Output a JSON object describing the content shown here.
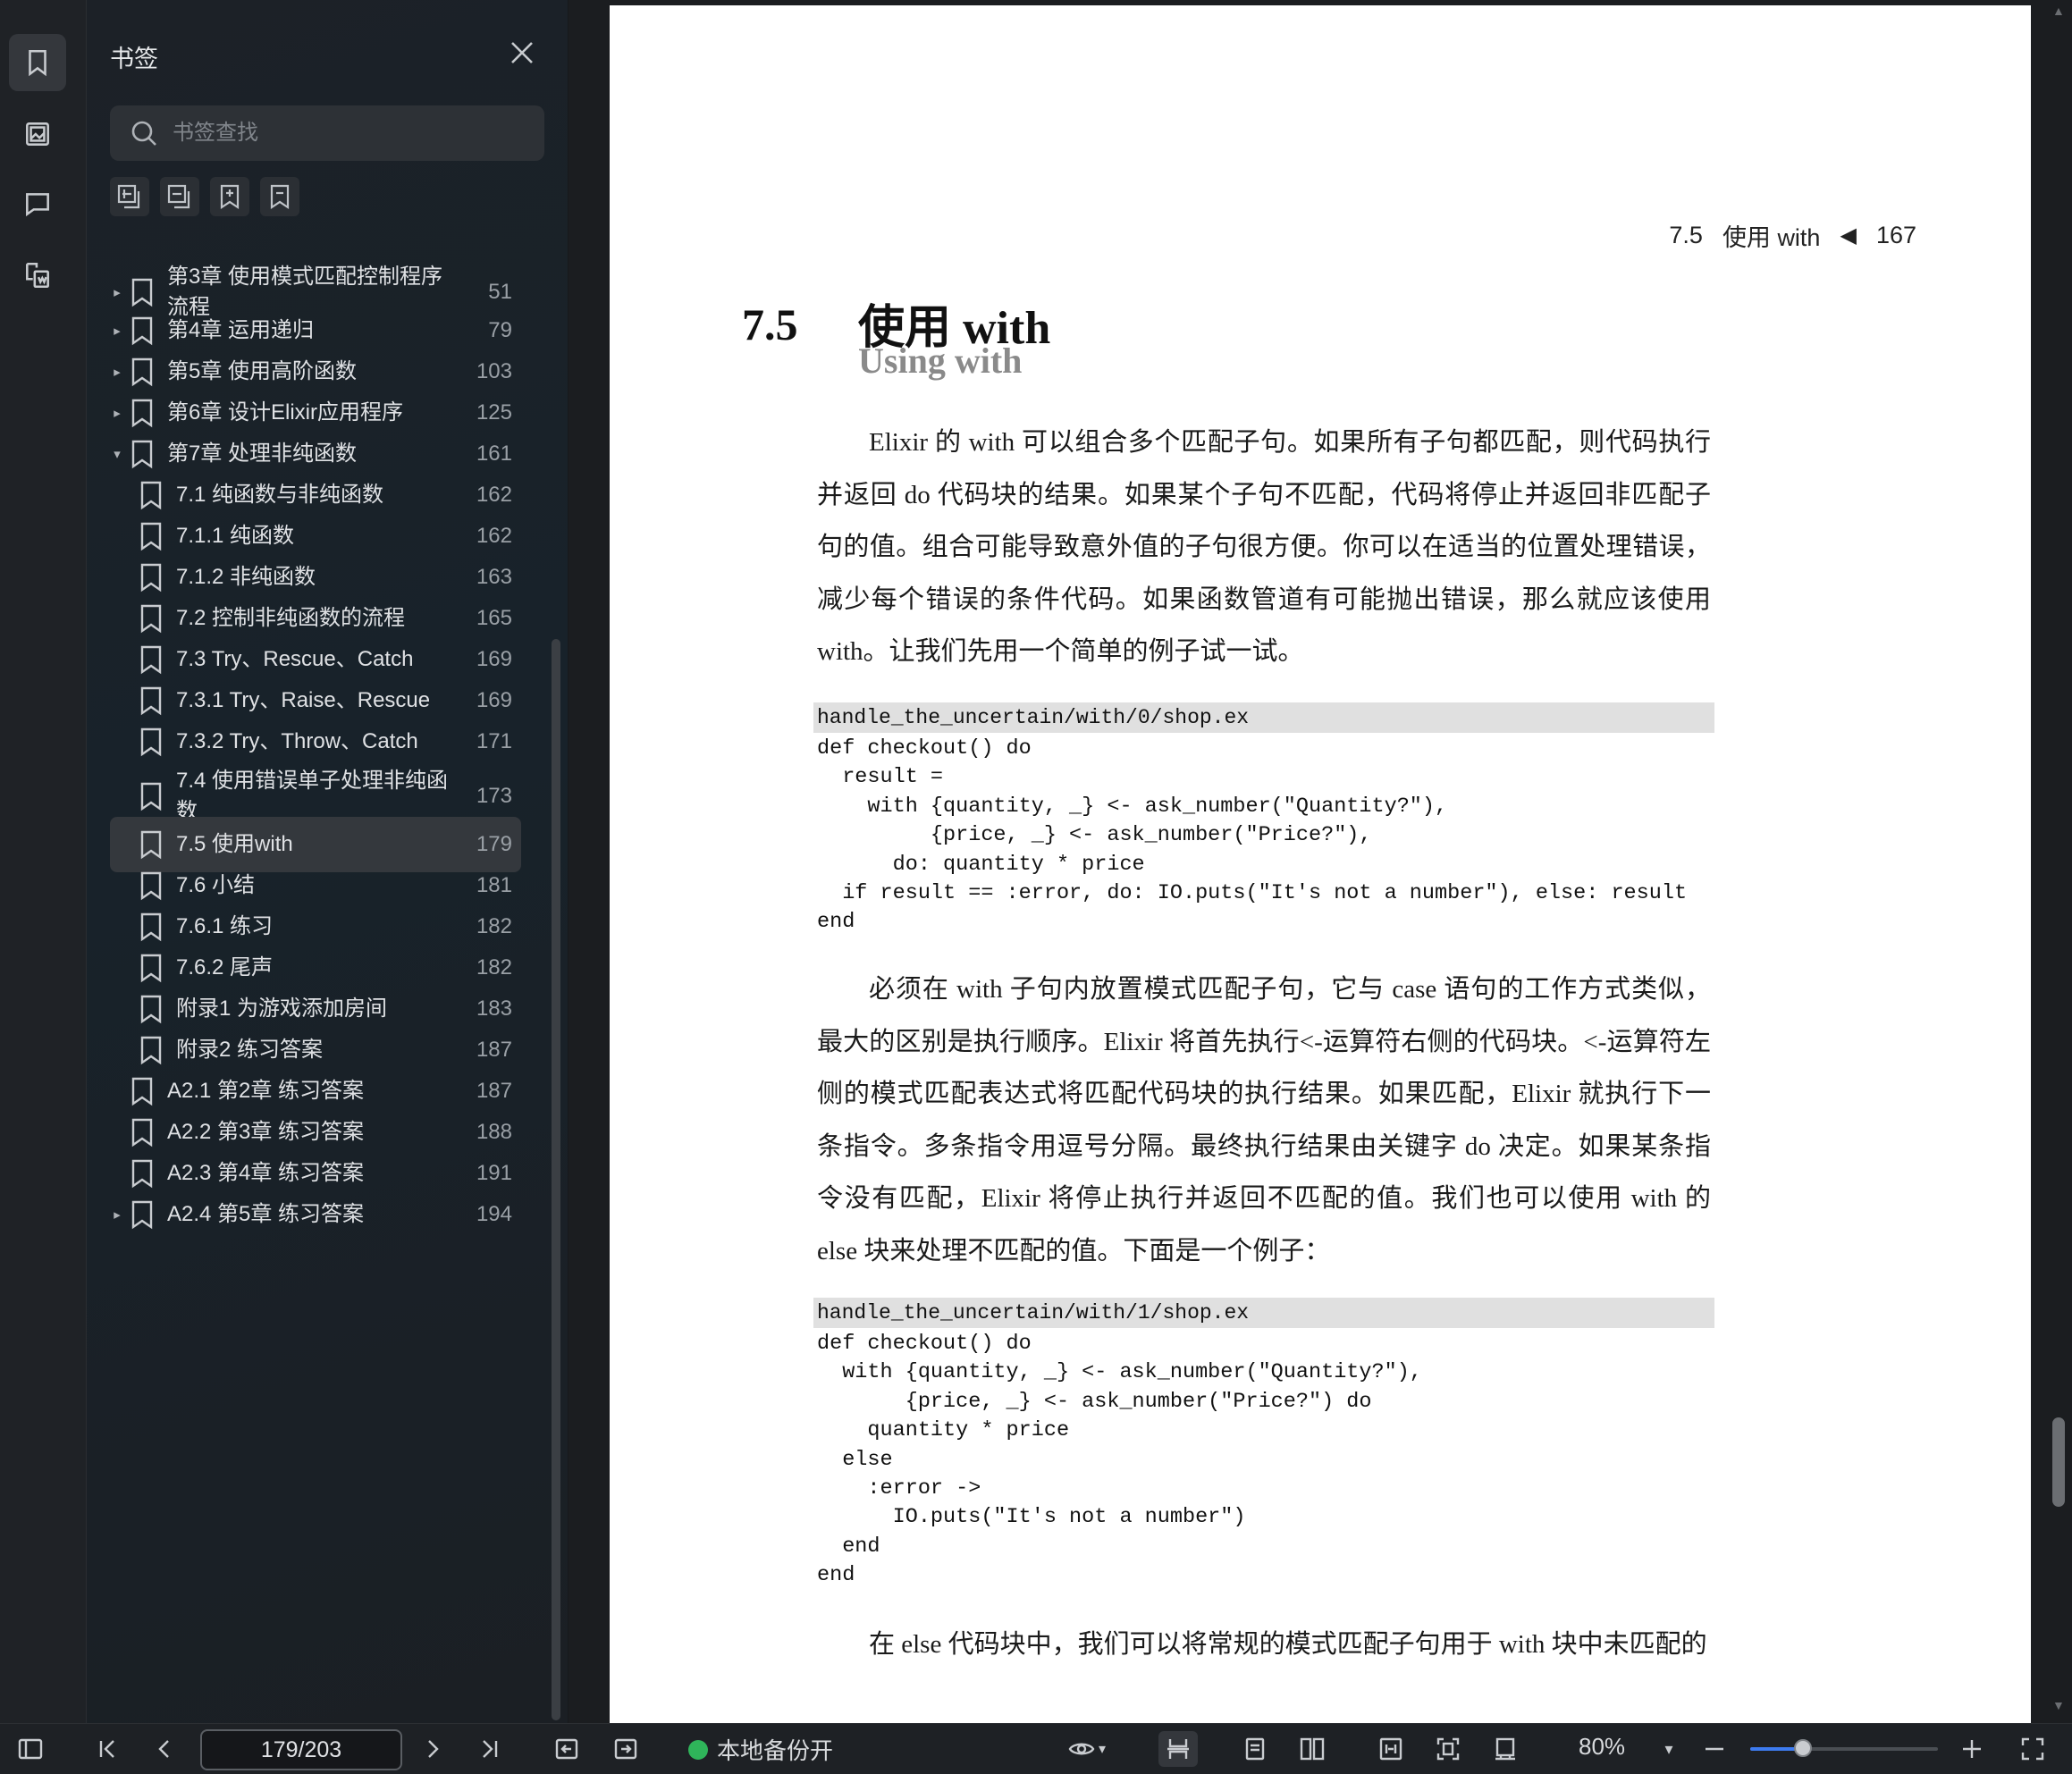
{
  "rail": {
    "items": [
      {
        "icon": "bookmark-icon",
        "active": true
      },
      {
        "icon": "image-thumbnail-icon",
        "active": false
      },
      {
        "icon": "comment-icon",
        "active": false
      },
      {
        "icon": "page-overview-icon",
        "active": false
      }
    ]
  },
  "panel": {
    "title": "书签",
    "search_placeholder": "书签查找",
    "tools": [
      "add-bookmark-icon",
      "add-sub-bookmark-icon",
      "bookmark-plus-icon",
      "bookmark-minus-icon"
    ],
    "items": [
      {
        "label": "第3章  使用模式匹配控制程序流程",
        "page": "51",
        "caret": "▸",
        "indent": 0
      },
      {
        "label": "第4章  运用递归",
        "page": "79",
        "caret": "▸",
        "indent": 0
      },
      {
        "label": "第5章  使用高阶函数",
        "page": "103",
        "caret": "▸",
        "indent": 0
      },
      {
        "label": "第6章  设计Elixir应用程序",
        "page": "125",
        "caret": "▸",
        "indent": 0
      },
      {
        "label": "第7章  处理非纯函数",
        "page": "161",
        "caret": "▾",
        "indent": 0
      },
      {
        "label": "7.1  纯函数与非纯函数",
        "page": "162",
        "caret": "",
        "indent": 1
      },
      {
        "label": "7.1.1  纯函数",
        "page": "162",
        "caret": "",
        "indent": 1
      },
      {
        "label": "7.1.2  非纯函数",
        "page": "163",
        "caret": "",
        "indent": 1
      },
      {
        "label": "7.2  控制非纯函数的流程",
        "page": "165",
        "caret": "",
        "indent": 1
      },
      {
        "label": "7.3  Try、Rescue、Catch",
        "page": "169",
        "caret": "",
        "indent": 1
      },
      {
        "label": "7.3.1  Try、Raise、Rescue",
        "page": "169",
        "caret": "",
        "indent": 1
      },
      {
        "label": "7.3.2  Try、Throw、Catch",
        "page": "171",
        "caret": "",
        "indent": 1
      },
      {
        "label": "7.4  使用错误单子处理非纯函数",
        "page": "173",
        "caret": "",
        "indent": 1
      },
      {
        "label": "7.5  使用with",
        "page": "179",
        "caret": "",
        "indent": 1,
        "selected": true
      },
      {
        "label": "7.6  小结",
        "page": "181",
        "caret": "",
        "indent": 1
      },
      {
        "label": "7.6.1  练习",
        "page": "182",
        "caret": "",
        "indent": 1
      },
      {
        "label": "7.6.2  尾声",
        "page": "182",
        "caret": "",
        "indent": 1
      },
      {
        "label": "附录1  为游戏添加房间",
        "page": "183",
        "caret": "",
        "indent": 1
      },
      {
        "label": "附录2  练习答案",
        "page": "187",
        "caret": "",
        "indent": 1
      },
      {
        "label": "A2.1  第2章  练习答案",
        "page": "187",
        "caret": "",
        "indent": 0
      },
      {
        "label": "A2.2  第3章  练习答案",
        "page": "188",
        "caret": "",
        "indent": 0
      },
      {
        "label": "A2.3  第4章  练习答案",
        "page": "191",
        "caret": "",
        "indent": 0
      },
      {
        "label": "A2.4  第5章  练习答案",
        "page": "194",
        "caret": "▸",
        "indent": 0
      }
    ]
  },
  "doc": {
    "running_head": {
      "section": "7.5",
      "title": "使用 with",
      "arrow": "◀",
      "page": "167"
    },
    "section_number": "7.5",
    "section_title": "使用 with",
    "section_subtitle": "Using with",
    "para1": "Elixir 的 with 可以组合多个匹配子句。如果所有子句都匹配，则代码执行并返回 do 代码块的结果。如果某个子句不匹配，代码将停止并返回非匹配子句的值。组合可能导致意外值的子句很方便。你可以在适当的位置处理错误，减少每个错误的条件代码。如果函数管道有可能抛出错误，那么就应该使用 with。让我们先用一个简单的例子试一试。",
    "code1_title": "handle_the_uncertain/with/0/shop.ex",
    "code1": "def checkout() do\n  result =\n    with {quantity, _} <- ask_number(\"Quantity?\"),\n         {price, _} <- ask_number(\"Price?\"),\n      do: quantity * price\n  if result == :error, do: IO.puts(\"It's not a number\"), else: result\nend",
    "para2": "必须在 with 子句内放置模式匹配子句，它与 case 语句的工作方式类似，最大的区别是执行顺序。Elixir 将首先执行<-运算符右侧的代码块。<-运算符左侧的模式匹配表达式将匹配代码块的执行结果。如果匹配，Elixir 就执行下一条指令。多条指令用逗号分隔。最终执行结果由关键字 do 决定。如果某条指令没有匹配，Elixir 将停止执行并返回不匹配的值。我们也可以使用 with 的 else 块来处理不匹配的值。下面是一个例子：",
    "code2_title": "handle_the_uncertain/with/1/shop.ex",
    "code2": "def checkout() do\n  with {quantity, _} <- ask_number(\"Quantity?\"),\n       {price, _} <- ask_number(\"Price?\") do\n    quantity * price\n  else\n    :error ->\n      IO.puts(\"It's not a number\")\n  end\nend",
    "para3": "在 else 代码块中，我们可以将常规的模式匹配子句用于 with 块中未匹配的"
  },
  "bottombar": {
    "page_value": "179/203",
    "backup_label": "本地备份开",
    "zoom_label": "80%",
    "zoom_fraction": 0.28
  }
}
